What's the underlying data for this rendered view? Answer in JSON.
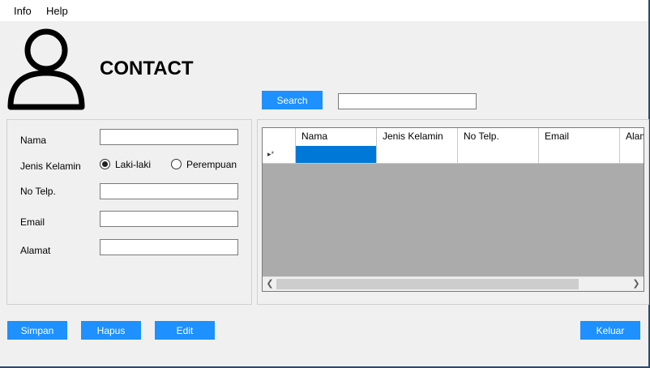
{
  "menu": {
    "info": "Info",
    "help": "Help"
  },
  "page": {
    "title": "CONTACT"
  },
  "search": {
    "button_label": "Search",
    "value": ""
  },
  "form": {
    "nama_label": "Nama",
    "jenis_kelamin_label": "Jenis Kelamin",
    "gender_options": [
      "Laki-laki",
      "Perempuan"
    ],
    "gender_selected": "Laki-laki",
    "no_telp_label": "No Telp.",
    "email_label": "Email",
    "alamat_label": "Alamat",
    "nama_value": "",
    "no_telp_value": "",
    "email_value": "",
    "alamat_value": ""
  },
  "grid": {
    "row_marker": "▸*",
    "columns": [
      "Nama",
      "Jenis Kelamin",
      "No Telp.",
      "Email",
      "Alamat"
    ],
    "rows": [],
    "selection_color": "#0078d7"
  },
  "actions": {
    "simpan": "Simpan",
    "hapus": "Hapus",
    "edit": "Edit",
    "keluar": "Keluar"
  },
  "colors": {
    "accent": "#1e90ff",
    "grid_empty": "#ababab"
  }
}
